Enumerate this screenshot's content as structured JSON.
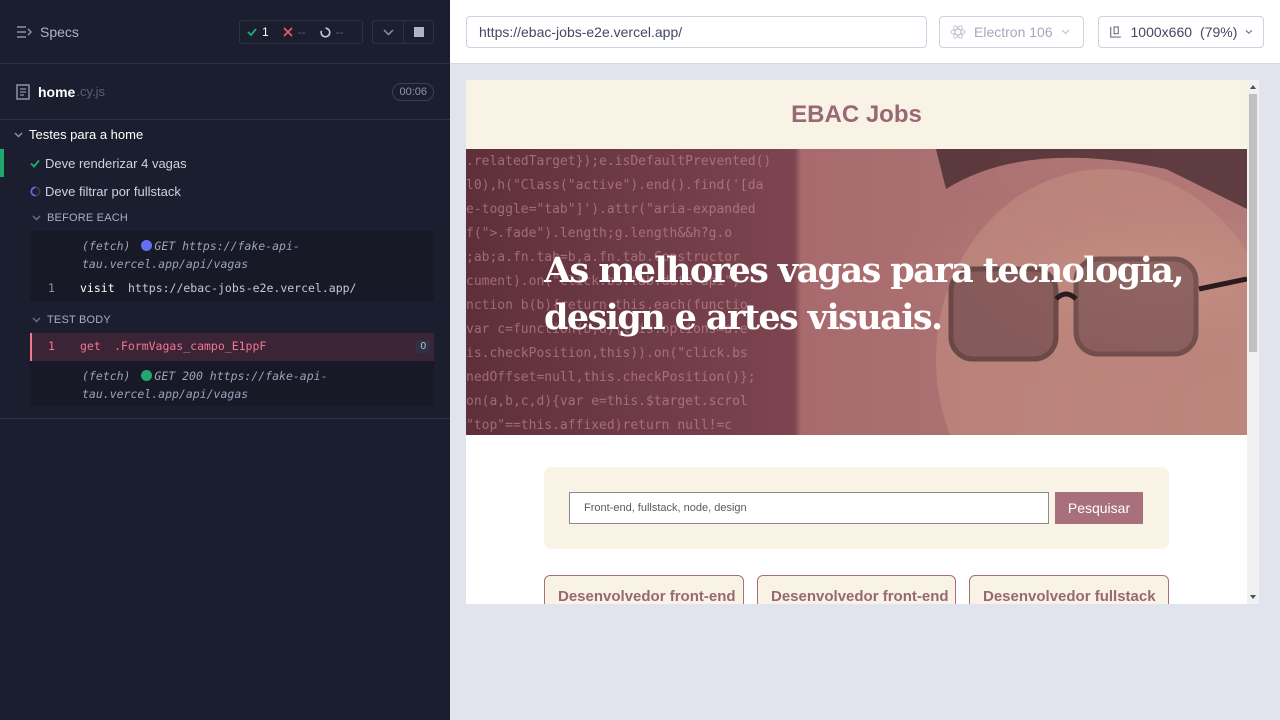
{
  "reporter": {
    "specs_label": "Specs",
    "stats": {
      "passed": "1",
      "failed": "--",
      "pending": "--"
    },
    "spec": {
      "name": "home",
      "ext": ".cy.js",
      "duration": "00:06"
    },
    "suite": {
      "title": "Testes para a home"
    },
    "tests": [
      {
        "title": "Deve renderizar 4 vagas",
        "state": "passed"
      },
      {
        "title": "Deve filtrar por fullstack",
        "state": "running"
      }
    ],
    "before_each": {
      "title": "BEFORE EACH",
      "fetch_label": "(fetch)",
      "fetch_text_1": "GET https://fake-api-",
      "fetch_text_2": "tau.vercel.app/api/vagas",
      "visit_num": "1",
      "visit_cmd": "visit",
      "visit_url": "https://ebac-jobs-e2e.vercel.app/"
    },
    "test_body": {
      "title": "TEST BODY",
      "get_num": "1",
      "get_cmd": "get",
      "get_selector": ".FormVagas_campo_E1ppF",
      "get_count": "0",
      "fetch_label": "(fetch)",
      "fetch_text_1": "GET 200 https://fake-api-",
      "fetch_text_2": "tau.vercel.app/api/vagas"
    },
    "colors": {
      "passed": "#1fa971",
      "failed": "#e45770",
      "active": "#f3778f",
      "dot_pending": "#6470f3",
      "dot_done": "#1fa971"
    }
  },
  "aut": {
    "url": "https://ebac-jobs-e2e.vercel.app/",
    "browser": "Electron 106",
    "viewport": "1000x660",
    "zoom": "(79%)"
  },
  "site": {
    "title": "EBAC Jobs",
    "hero_line1": "As melhores vagas para tecnologia,",
    "hero_line2": "design e artes visuais.",
    "search_placeholder": "Front-end, fullstack, node, design",
    "search_button": "Pesquisar",
    "jobs": [
      "Desenvolvedor front-end",
      "Desenvolvedor front-end",
      "Desenvolvedor fullstack"
    ],
    "colors": {
      "brand": "#996874",
      "cream": "#f8f3e5",
      "button": "#a7707c"
    }
  },
  "icons": [
    "specs-icon",
    "check-icon",
    "x-icon",
    "spinner-icon",
    "chevron-down-icon",
    "stop-icon",
    "file-icon",
    "electron-icon",
    "viewport-icon"
  ]
}
